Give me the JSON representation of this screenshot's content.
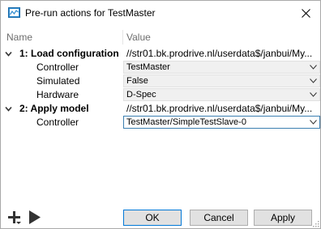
{
  "window": {
    "title": "Pre-run actions for TestMaster",
    "app_icon": "chart-window-icon",
    "close_icon": "close-icon"
  },
  "columns": {
    "name": "Name",
    "value": "Value"
  },
  "groups": [
    {
      "label": "1: Load configuration",
      "value": "//str01.bk.prodrive.nl/userdata$/janbui/My...",
      "expanded": true,
      "properties": [
        {
          "label": "Controller",
          "value": "TestMaster"
        },
        {
          "label": "Simulated",
          "value": "False"
        },
        {
          "label": "Hardware",
          "value": "D-Spec"
        }
      ]
    },
    {
      "label": "2: Apply model",
      "value": "//str01.bk.prodrive.nl/userdata$/janbui/My...",
      "expanded": true,
      "properties": [
        {
          "label": "Controller",
          "value": "TestMaster/SimpleTestSlave-0"
        }
      ]
    }
  ],
  "footer": {
    "add_icon": "add-dropdown-icon",
    "run_icon": "play-icon",
    "ok_label": "OK",
    "cancel_label": "Cancel",
    "apply_label": "Apply"
  },
  "colors": {
    "accent": "#0078d7",
    "combo_bg": "#f0f0f0",
    "header_text": "#6d6d6d"
  }
}
